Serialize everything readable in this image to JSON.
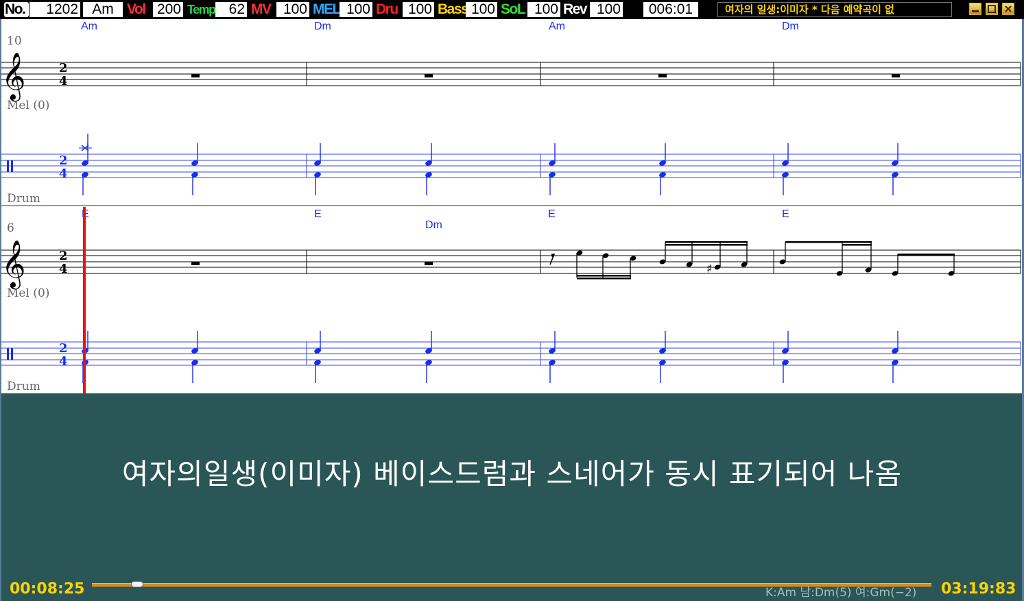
{
  "toolbar": {
    "no_label": "No.",
    "no_value": "1202",
    "key_value": "Am",
    "vol_label": "Vol",
    "vol_value": "200",
    "temp_label": "Temp",
    "temp_value": "62",
    "mv_label": "MV",
    "mv_value": "100",
    "mel_label": "MEL",
    "mel_value": "100",
    "dru_label": "Dru",
    "dru_value": "100",
    "bass_label": "Bass",
    "bass_value": "100",
    "sol_label": "SoL",
    "sol_value": "100",
    "rev_label": "Rev",
    "rev_value": "100",
    "position": "006:01",
    "song_title": "여자의 일생:이미자 * 다음 예약곡이 없",
    "colors": {
      "no": "#ffffff",
      "vol": "#ff3030",
      "temp": "#20d840",
      "mv": "#ff3030",
      "mel": "#30a8ff",
      "dru": "#ff2020",
      "bass": "#ffd000",
      "sol": "#30e030",
      "rev": "#ffffff",
      "title": "#ffd200"
    }
  },
  "window_controls": [
    "minimize-icon",
    "maximize-icon",
    "close-icon"
  ],
  "score": {
    "systems": [
      {
        "measure_number": "10",
        "chords": [
          "Am",
          "Dm",
          "Am",
          "Dm"
        ],
        "melody_label": "Mel (0)",
        "drum_label": "Drum",
        "time_signature": [
          "2",
          "4"
        ]
      },
      {
        "measure_number": "6",
        "chords": [
          "E",
          "E",
          "Dm",
          "E",
          "E"
        ],
        "melody_label": "Mel (0)",
        "drum_label": "Drum",
        "time_signature": [
          "2",
          "4"
        ]
      }
    ],
    "note_color": "#1a2ee6",
    "cursor_color": "#ee1111"
  },
  "lyrics": "여자의일생(이미자) 베이스드럼과 스네어가 동시 표기되어 나옴",
  "status": {
    "elapsed": "00:08:25",
    "remaining": "03:19:83",
    "key_info": "K:Am 남:Dm(5) 여:Gm(−2)",
    "progress": 0.05
  }
}
